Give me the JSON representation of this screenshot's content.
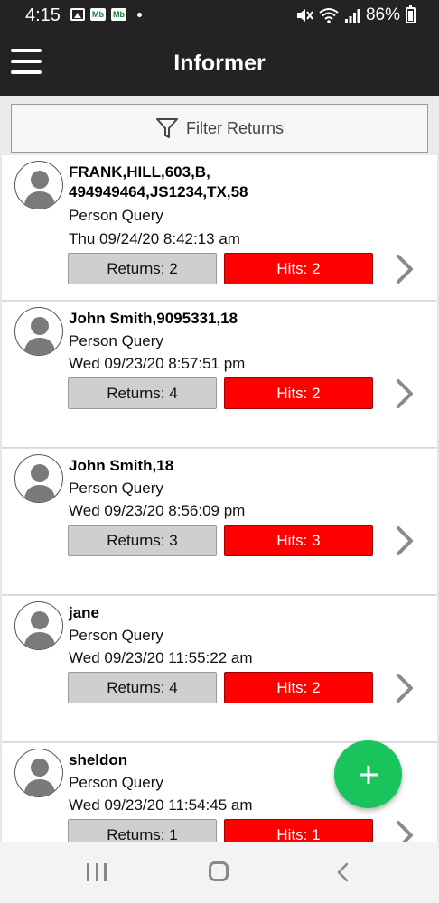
{
  "status_bar": {
    "time": "4:15",
    "left_icons": [
      "gallery-icon",
      "mb-icon",
      "mb-icon",
      "dot-icon"
    ],
    "mb_label": "Mb",
    "battery": "86%"
  },
  "app_bar": {
    "title": "Informer",
    "menu_icon": "hamburger-menu-icon"
  },
  "filter": {
    "label": "Filter Returns",
    "icon": "filter-icon"
  },
  "queries": [
    {
      "title": "FRANK,HILL,603,B,\n494949464,JS1234,TX,58",
      "type": "Person Query",
      "date": "Thu 09/24/20 8:42:13 am",
      "returns": "Returns: 2",
      "hits": "Hits: 2"
    },
    {
      "title": "John Smith,9095331,18",
      "type": "Person Query",
      "date": "Wed 09/23/20 8:57:51 pm",
      "returns": "Returns: 4",
      "hits": "Hits: 2"
    },
    {
      "title": "John Smith,18",
      "type": "Person Query",
      "date": "Wed 09/23/20 8:56:09 pm",
      "returns": "Returns: 3",
      "hits": "Hits: 3"
    },
    {
      "title": "jane",
      "type": "Person Query",
      "date": "Wed 09/23/20 11:55:22 am",
      "returns": "Returns: 4",
      "hits": "Hits: 2"
    },
    {
      "title": "sheldon",
      "type": "Person Query",
      "date": "Wed 09/23/20 11:54:45 am",
      "returns": "Returns: 1",
      "hits": "Hits: 1"
    }
  ],
  "colors": {
    "app_bar": "#232323",
    "hits": "#ff0000",
    "returns": "#cfcfcf",
    "fab": "#19c45c"
  }
}
